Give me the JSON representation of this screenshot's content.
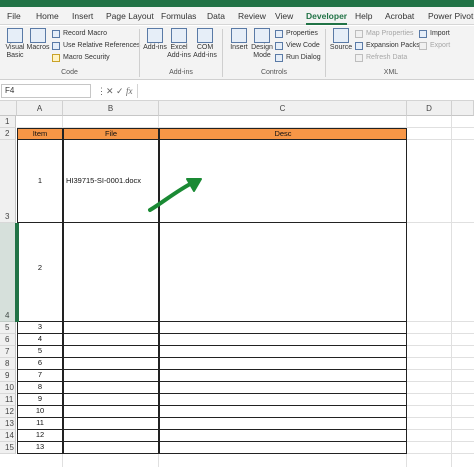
{
  "menu": {
    "tabs": [
      "File",
      "Home",
      "Insert",
      "Page Layout",
      "Formulas",
      "Data",
      "Review",
      "View",
      "Developer",
      "Help",
      "Acrobat",
      "Power Pivot"
    ],
    "active": "Developer"
  },
  "ribbon": {
    "code": {
      "label": "Code",
      "visual_basic": "Visual Basic",
      "macros": "Macros",
      "record_macro": "Record Macro",
      "relative_refs": "Use Relative References",
      "macro_security": "Macro Security"
    },
    "addins": {
      "label": "Add-ins",
      "addins": "Add-ins",
      "excel_addins": "Excel Add-ins",
      "com_addins": "COM Add-ins"
    },
    "controls": {
      "label": "Controls",
      "insert": "Insert",
      "design_mode": "Design Mode",
      "properties": "Properties",
      "view_code": "View Code",
      "run_dialog": "Run Dialog"
    },
    "xml": {
      "label": "XML",
      "source": "Source",
      "map_properties": "Map Properties",
      "expansion_packs": "Expansion Packs",
      "refresh_data": "Refresh Data",
      "import": "Import",
      "export": "Export"
    }
  },
  "formula_bar": {
    "name_box": "F4",
    "fx": "fx"
  },
  "sheet": {
    "columns": [
      "A",
      "B",
      "C",
      "D"
    ],
    "rows": [
      "1",
      "2",
      "3",
      "4",
      "5",
      "6",
      "7",
      "8",
      "9",
      "10",
      "11",
      "12",
      "13",
      "14",
      "15"
    ],
    "header": {
      "item": "Item",
      "file": "File",
      "desc": "Desc"
    },
    "table_rows": [
      {
        "item": "1",
        "file": "HI39715-SI-0001.docx",
        "desc": ""
      },
      {
        "item": "2",
        "file": "",
        "desc": ""
      },
      {
        "item": "3",
        "file": "",
        "desc": ""
      },
      {
        "item": "4",
        "file": "",
        "desc": ""
      },
      {
        "item": "5",
        "file": "",
        "desc": ""
      },
      {
        "item": "6",
        "file": "",
        "desc": ""
      },
      {
        "item": "7",
        "file": "",
        "desc": ""
      },
      {
        "item": "8",
        "file": "",
        "desc": ""
      },
      {
        "item": "9",
        "file": "",
        "desc": ""
      },
      {
        "item": "10",
        "file": "",
        "desc": ""
      },
      {
        "item": "11",
        "file": "",
        "desc": ""
      },
      {
        "item": "12",
        "file": "",
        "desc": ""
      },
      {
        "item": "13",
        "file": "",
        "desc": ""
      }
    ]
  },
  "colors": {
    "accent": "#217346",
    "header_fill": "#f79646",
    "arrow": "#1a8a34"
  }
}
